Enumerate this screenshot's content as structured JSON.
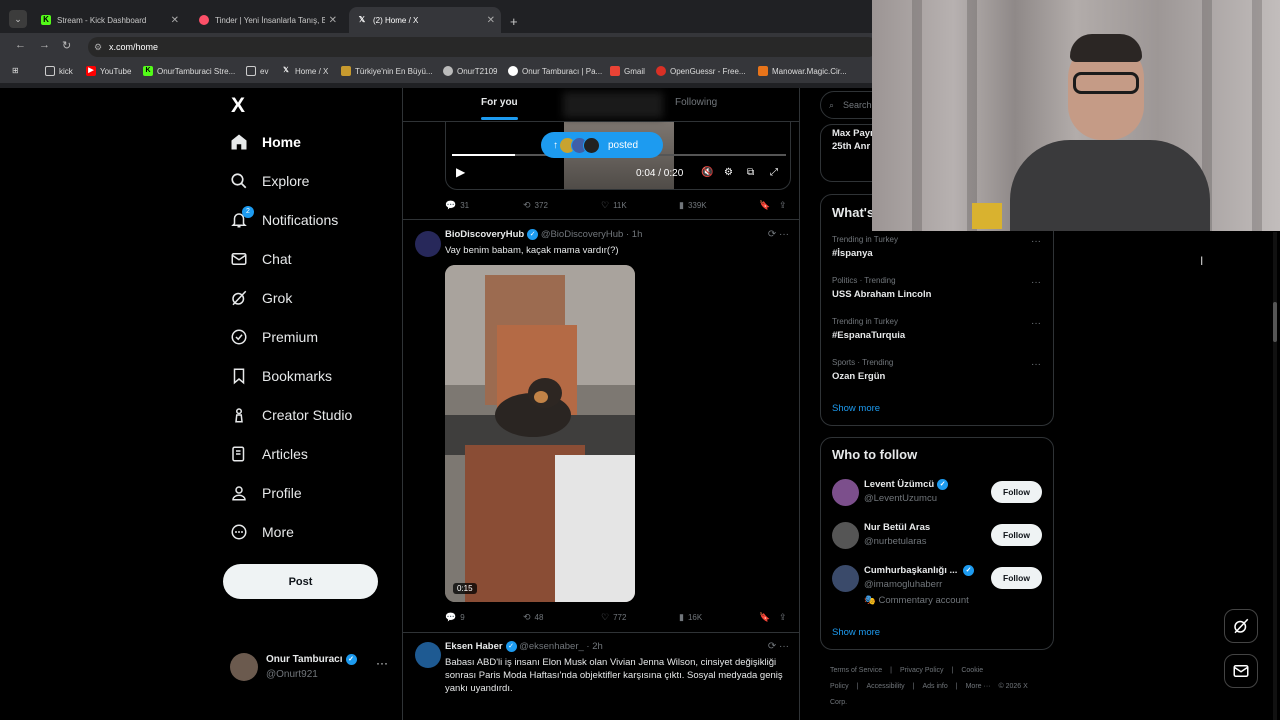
{
  "browser": {
    "tabs": [
      {
        "title": "Stream - Kick Dashboard",
        "favicon": "kick-icon",
        "color": "#53fc18"
      },
      {
        "title": "Tinder | Yeni İnsanlarla Tanış, Bi",
        "favicon": "tinder-icon",
        "color": "#fd5068"
      },
      {
        "title": "(2) Home / X",
        "favicon": "x-icon",
        "color": "#ffffff"
      }
    ],
    "url": "x.com/home",
    "bookmarks": [
      "kick",
      "YouTube",
      "OnurTamburaci Stre...",
      "ev",
      "Home / X",
      "Türkiye'nin En Büyü...",
      "OnurT2109",
      "Onur Tamburacı | Pa...",
      "Gmail",
      "OpenGuessr - Free...",
      "Manowar.Magic.Cir..."
    ]
  },
  "nav": {
    "logo": "X",
    "items": [
      {
        "label": "Home",
        "icon": "home-icon"
      },
      {
        "label": "Explore",
        "icon": "search-icon"
      },
      {
        "label": "Notifications",
        "icon": "bell-icon",
        "badge": "2"
      },
      {
        "label": "Chat",
        "icon": "mail-icon"
      },
      {
        "label": "Grok",
        "icon": "grok-icon"
      },
      {
        "label": "Premium",
        "icon": "premium-icon"
      },
      {
        "label": "Bookmarks",
        "icon": "bookmark-icon"
      },
      {
        "label": "Creator Studio",
        "icon": "creator-studio-icon"
      },
      {
        "label": "Articles",
        "icon": "articles-icon"
      },
      {
        "label": "Profile",
        "icon": "person-icon"
      },
      {
        "label": "More",
        "icon": "more-circle-icon"
      }
    ],
    "post_label": "Post",
    "profile": {
      "name": "Onur Tamburacı",
      "handle": "@Onurt921"
    }
  },
  "feed": {
    "tabs": {
      "for_you": "For you",
      "following": "Following"
    },
    "posted_pill": "posted",
    "video1": {
      "time": "0:04 / 0:20",
      "progress": 0.19
    },
    "post1_stats": {
      "replies": "31",
      "reposts": "372",
      "likes": "11K",
      "views": "339K"
    },
    "post2": {
      "name": "BioDiscoveryHub",
      "handle": "@BioDiscoveryHub",
      "time": "· 1h",
      "text": "Vay benim babam, kaçak mama vardır(?)",
      "duration": "0:15",
      "stats": {
        "replies": "9",
        "reposts": "48",
        "likes": "772",
        "views": "16K"
      }
    },
    "post3": {
      "name": "Eksen Haber",
      "handle": "@eksenhaber_",
      "time": "· 2h",
      "text": "Babası ABD'li iş insanı Elon Musk olan Vivian Jenna Wilson, cinsiyet değişikliği sonrası Paris Moda Haftası'nda objektifler karşısına çıktı. Sosyal medyada geniş yankı uyandırdı."
    }
  },
  "sidebar": {
    "search_placeholder": "Search",
    "live_card": {
      "title_l1": "Max Payı",
      "title_l2": "25th Anr"
    },
    "whats_happening": "What's",
    "trends": [
      {
        "meta": "Trending in Turkey",
        "name": "#İspanya"
      },
      {
        "meta": "Politics · Trending",
        "name": "USS Abraham Lincoln"
      },
      {
        "meta": "Trending in Turkey",
        "name": "#EspanaTurquia"
      },
      {
        "meta": "Sports · Trending",
        "name": "Ozan Ergün"
      }
    ],
    "show_more": "Show more",
    "who_to_follow": "Who to follow",
    "follow_label": "Follow",
    "accounts": [
      {
        "name": "Levent Üzümcü",
        "handle": "@LeventUzumcu",
        "verified": true
      },
      {
        "name": "Nur Betül Aras",
        "handle": "@nurbetularas",
        "verified": false
      },
      {
        "name": "Cumhurbaşkanlığı ...",
        "handle": "@imamogluhaberr",
        "verified": true,
        "extra": "Commentary account"
      }
    ],
    "show_more2": "Show more",
    "footer": [
      "Terms of Service",
      "|",
      "Privacy Policy",
      "|",
      "Cookie Policy",
      "|",
      "Accessibility",
      "|",
      "Ads info",
      "|",
      "More ···",
      "© 2026 X Corp."
    ]
  },
  "colors": {
    "accent": "#1d9bf0",
    "background": "#000000",
    "border": "#2f3336",
    "muted": "#71767b"
  }
}
